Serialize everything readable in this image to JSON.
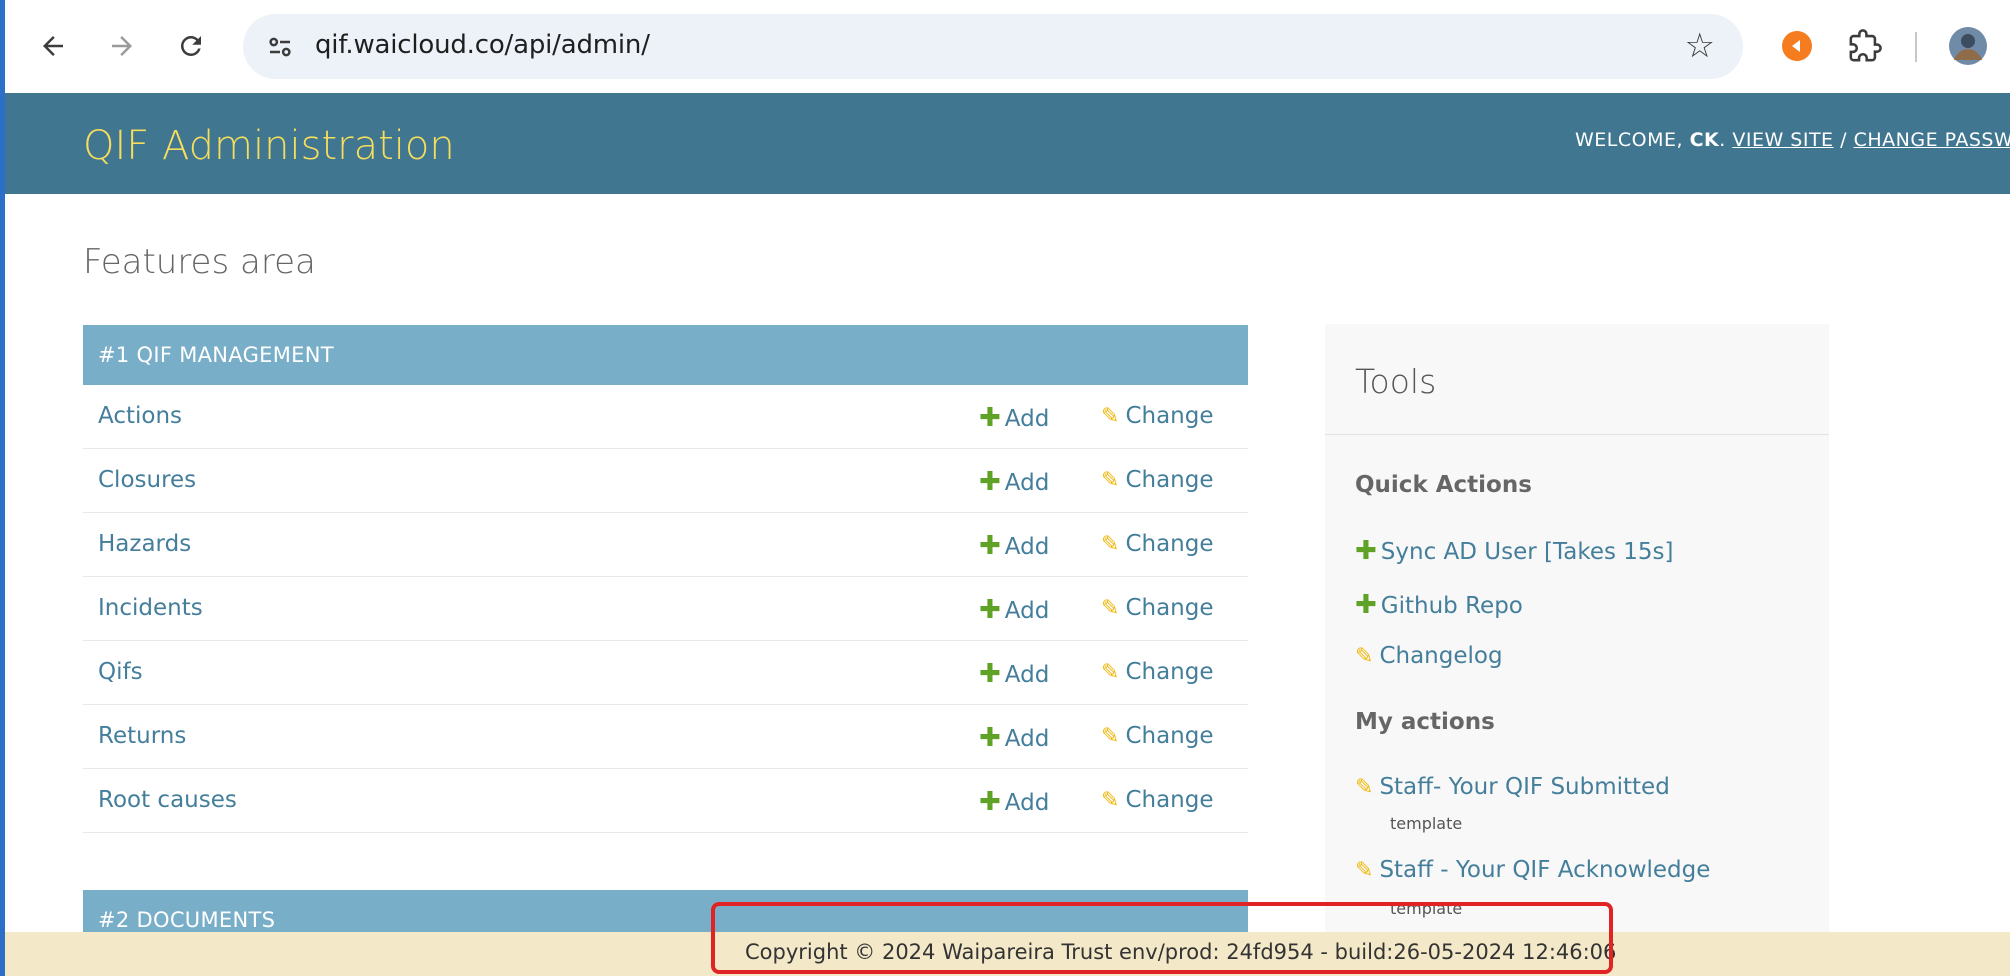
{
  "browser": {
    "url": "qif.waicloud.co/api/admin/",
    "icons": [
      "back-arrow-icon",
      "forward-arrow-icon",
      "reload-icon",
      "site-info-icon",
      "bookmark-star-icon",
      "extension-orange-icon",
      "puzzle-extensions-icon",
      "profile-avatar-icon"
    ]
  },
  "header": {
    "site_title": "QIF Administration",
    "welcome": "WELCOME,",
    "username": "CK",
    "view_site": "VIEW SITE",
    "separator": "/",
    "change_password": "CHANGE PASSW"
  },
  "page": {
    "title": "Features area"
  },
  "modules": [
    {
      "caption": "#1 QIF MANAGEMENT",
      "rows": [
        {
          "name": "Actions",
          "add": "Add",
          "change": "Change"
        },
        {
          "name": "Closures",
          "add": "Add",
          "change": "Change"
        },
        {
          "name": "Hazards",
          "add": "Add",
          "change": "Change"
        },
        {
          "name": "Incidents",
          "add": "Add",
          "change": "Change"
        },
        {
          "name": "Qifs",
          "add": "Add",
          "change": "Change"
        },
        {
          "name": "Returns",
          "add": "Add",
          "change": "Change"
        },
        {
          "name": "Root causes",
          "add": "Add",
          "change": "Change"
        }
      ]
    },
    {
      "caption": "#2 DOCUMENTS",
      "rows": []
    }
  ],
  "tools": {
    "title": "Tools",
    "quick_actions_heading": "Quick Actions",
    "quick_actions": [
      {
        "label": "Sync AD User [Takes 15s]",
        "icon": "plus-icon"
      },
      {
        "label": "Github Repo",
        "icon": "plus-icon"
      },
      {
        "label": "Changelog",
        "icon": "pencil-icon"
      }
    ],
    "my_actions_heading": "My actions",
    "my_actions": [
      {
        "label": "Staff- Your QIF Submitted",
        "sub": "template"
      },
      {
        "label": "Staff - Your QIF Acknowledge",
        "sub": "template"
      }
    ]
  },
  "footer": {
    "text": "Copyright © 2024 Waipareira Trust env/prod: 24fd954 - build:26-05-2024 12:46:06"
  },
  "colors": {
    "header_bg": "#417690",
    "site_title": "#f5dd5d",
    "module_caption_bg": "#79aec8",
    "link": "#447e9b",
    "add_icon": "#5fa225",
    "change_icon": "#efb80b",
    "footer_bg": "#f3e8c8",
    "highlight": "#e02424"
  }
}
